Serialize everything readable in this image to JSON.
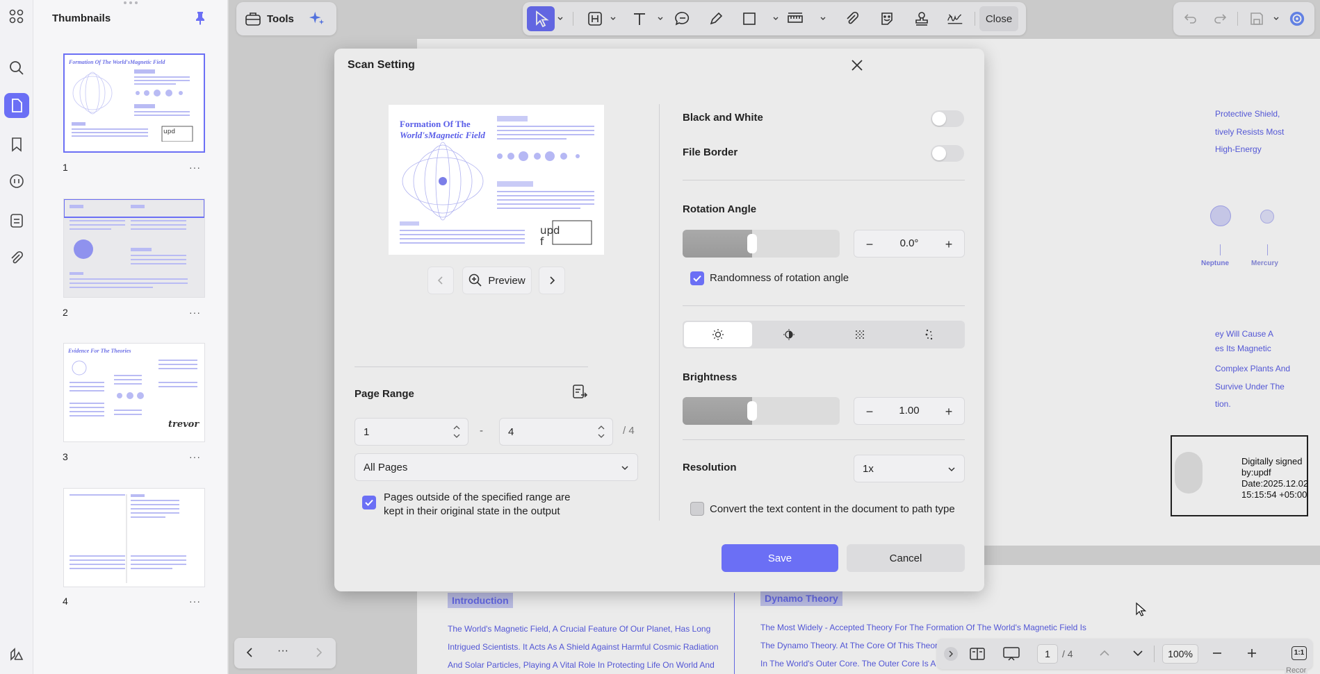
{
  "left_rail": {
    "icons": [
      "apps-icon",
      "search-icon",
      "pages-icon",
      "bookmark-icon",
      "comment-icon",
      "form-icon",
      "attachment-icon",
      "layers-icon"
    ]
  },
  "thumbnails": {
    "title": "Thumbnails",
    "pages": [
      {
        "number": "1",
        "title": "Formation Of The World'sMagnetic Field"
      },
      {
        "number": "2",
        "title": ""
      },
      {
        "number": "3",
        "title": "Evidence For The Theories"
      },
      {
        "number": "4",
        "title": ""
      }
    ],
    "more": "···"
  },
  "toolbar": {
    "tools_label": "Tools",
    "close_label": "Close"
  },
  "document": {
    "right_text_1": [
      "Protective Shield,",
      "tively Resists Most",
      "High-Energy"
    ],
    "planets": [
      "Neptune",
      "Mercury"
    ],
    "right_text_2": [
      "ey Will Cause A",
      "es Its Magnetic",
      "Complex Plants And",
      "Survive Under The",
      "tion."
    ],
    "signature": {
      "label": "Digitally signed",
      "by": "by:updf",
      "date": "Date:2025.12.02",
      "time": "15:15:54 +05:00"
    },
    "intro_tag": "Introduction",
    "intro_lines": [
      "The World's Magnetic Field, A Crucial Feature Of Our Planet, Has Long",
      "Intrigued Scientists. It Acts As A Shield Against Harmful Cosmic Radiation",
      "And Solar Particles, Playing A Vital Role In Protecting Life On World And"
    ],
    "dynamo_tag": "Dynamo Theory",
    "dynamo_lines": [
      "The Most Widely - Accepted Theory For The Formation Of The World's Magnetic Field Is",
      "The Dynamo Theory. At The Core Of This Theor",
      "In The World's Outer Core. The Outer Core Is A"
    ]
  },
  "bottom_bar": {
    "page_current": "1",
    "page_total": "/ 4",
    "zoom": "100%",
    "fit_label": "1:1",
    "record_label": "Recor"
  },
  "modal": {
    "title": "Scan Setting",
    "preview": {
      "doc_title_line1": "Formation Of The",
      "doc_title_line2": "World'sMagnetic Field",
      "button_label": "Preview"
    },
    "page_range": {
      "label": "Page Range",
      "from": "1",
      "separator": "-",
      "to": "4",
      "total": "/ 4",
      "scope": "All Pages",
      "keep_outside_line1": "Pages outside of the specified range are",
      "keep_outside_line2": "kept in their original state in the output",
      "keep_outside_checked": true
    },
    "black_and_white": {
      "label": "Black and White",
      "on": false
    },
    "file_border": {
      "label": "File Border",
      "on": false
    },
    "rotation": {
      "label": "Rotation Angle",
      "value": "0.0°",
      "level": 0.5,
      "randomness_label": "Randomness of rotation angle",
      "randomness_checked": true
    },
    "effects": [
      "brightness-icon",
      "contrast-icon",
      "noise-icon",
      "dither-icon"
    ],
    "brightness": {
      "label": "Brightness",
      "value": "1.00",
      "level": 0.5
    },
    "resolution": {
      "label": "Resolution",
      "value": "1x"
    },
    "convert_path": {
      "label": "Convert the text content in the document to path type",
      "checked": false
    },
    "save_label": "Save",
    "cancel_label": "Cancel",
    "accent_color": "#6b6ff5"
  }
}
